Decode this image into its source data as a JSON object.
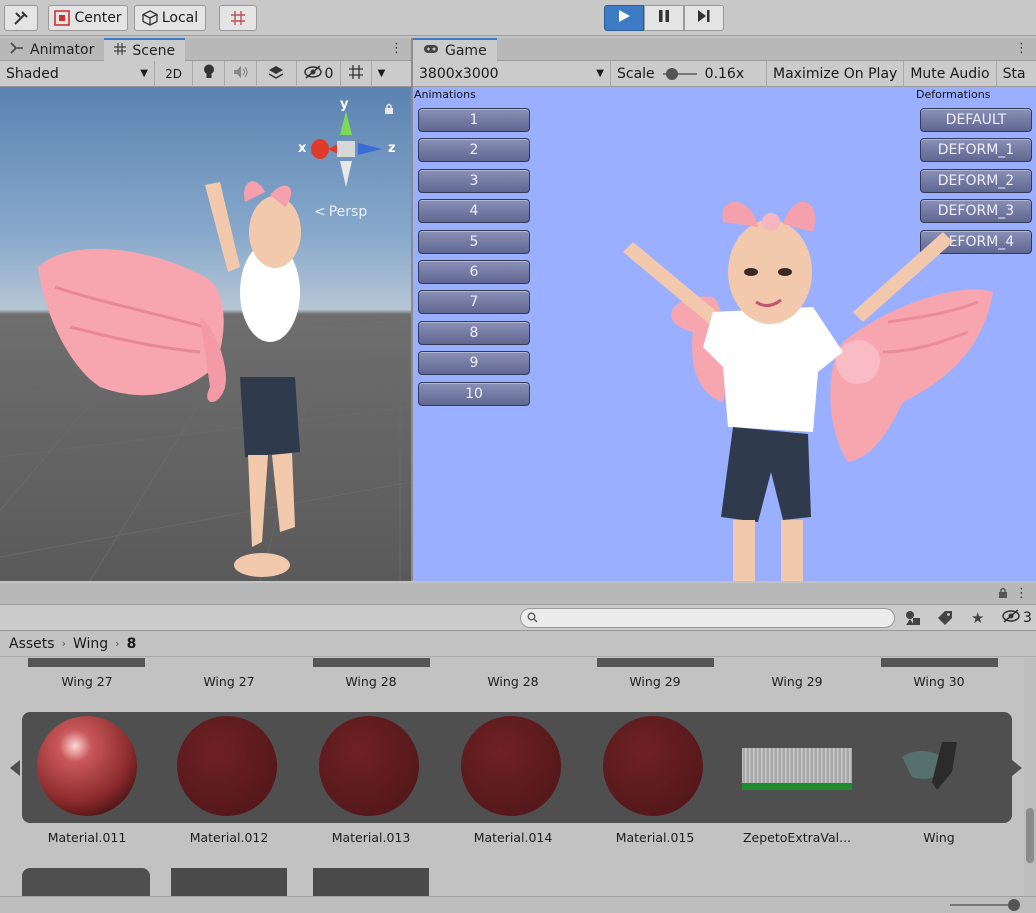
{
  "toolbar": {
    "pivot_label": "Center",
    "space_label": "Local"
  },
  "colors": {
    "accent": "#3d7bc4",
    "game_bg": "#9aafff",
    "button_fill": "#6b729a",
    "wing_pink": "#f7a6b0",
    "material_red": "#5e1b1e"
  },
  "scene": {
    "tabs": [
      {
        "label": "Animator",
        "icon": "animator-icon"
      },
      {
        "label": "Scene",
        "icon": "grid-icon"
      }
    ],
    "shading_mode": "Shaded",
    "mode_2d": "2D",
    "hidden_count": "0",
    "gizmo": {
      "y": "y",
      "x": "x",
      "z": "z",
      "projection": "Persp"
    }
  },
  "game": {
    "tab_label": "Game",
    "resolution": "3800x3000",
    "scale_label": "Scale",
    "scale_value": "0.16x",
    "scale_fraction": 0.15,
    "maximize_label": "Maximize On Play",
    "mute_label": "Mute Audio",
    "stats_label": "Sta",
    "animations_title": "Animations",
    "deformations_title": "Deformations",
    "animation_buttons": [
      "1",
      "2",
      "3",
      "4",
      "5",
      "6",
      "7",
      "8",
      "9",
      "10"
    ],
    "deformation_buttons": [
      "DEFAULT",
      "DEFORM_1",
      "DEFORM_2",
      "DEFORM_3",
      "DEFORM_4"
    ]
  },
  "project": {
    "hidden_count": "3",
    "breadcrumb": [
      "Assets",
      "Wing",
      "8"
    ],
    "row1_labels": [
      "Wing 27",
      "Wing 27",
      "Wing 28",
      "Wing 28",
      "Wing 29",
      "Wing 29",
      "Wing 30"
    ],
    "row2_labels": [
      "Material.011",
      "Material.012",
      "Material.013",
      "Material.014",
      "Material.015",
      "ZepetoExtraVal...",
      "Wing"
    ]
  }
}
